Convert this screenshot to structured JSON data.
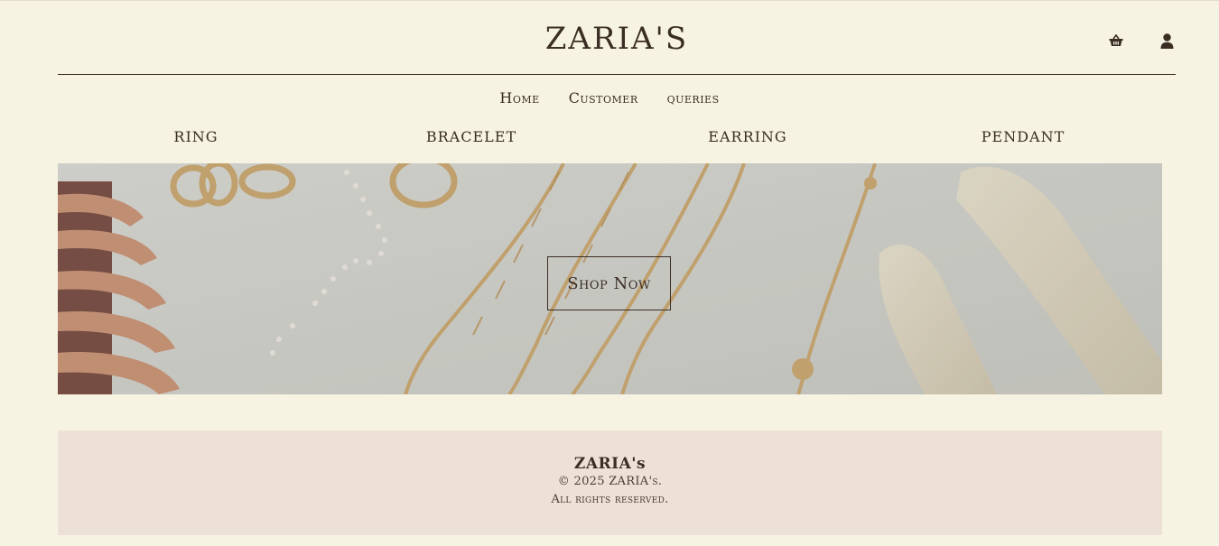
{
  "header": {
    "brand": "ZARIA'S",
    "icons": [
      "basket-icon",
      "user-icon"
    ]
  },
  "nav": {
    "items": [
      {
        "label": "Home"
      },
      {
        "label": "Customer"
      },
      {
        "label": "queries"
      }
    ]
  },
  "categories": [
    {
      "label": "RING"
    },
    {
      "label": "BRACELET"
    },
    {
      "label": "EARRING"
    },
    {
      "label": "PENDANT"
    }
  ],
  "hero": {
    "button_label": "Shop Now"
  },
  "footer": {
    "brand": "ZARIA's",
    "copyright": "© 2025 ZARIA's.",
    "rights": "All rights reserved."
  },
  "colors": {
    "background": "#f7f3e2",
    "text": "#3a2e24",
    "footer_bg": "#ede0d6",
    "hero_bg": "#d3d3cf",
    "gold": "#c9a46a"
  }
}
